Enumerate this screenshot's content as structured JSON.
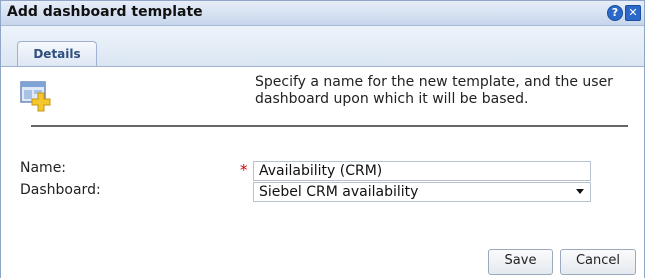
{
  "dialog": {
    "title": "Add dashboard template",
    "help_icon": "help-icon",
    "close_icon": "close-icon"
  },
  "tabs": [
    {
      "label": "Details",
      "active": true
    }
  ],
  "header": {
    "icon": "add-template-icon",
    "description": "Specify a name for the new template, and the user dashboard upon which it will be based."
  },
  "form": {
    "name": {
      "label": "Name:",
      "required_marker": "*",
      "value": "Availability (CRM)"
    },
    "dashboard": {
      "label": "Dashboard:",
      "selected": "Siebel CRM availability"
    }
  },
  "buttons": {
    "save": "Save",
    "cancel": "Cancel"
  },
  "colors": {
    "accent": "#2a68c9",
    "required": "#dd0000"
  }
}
